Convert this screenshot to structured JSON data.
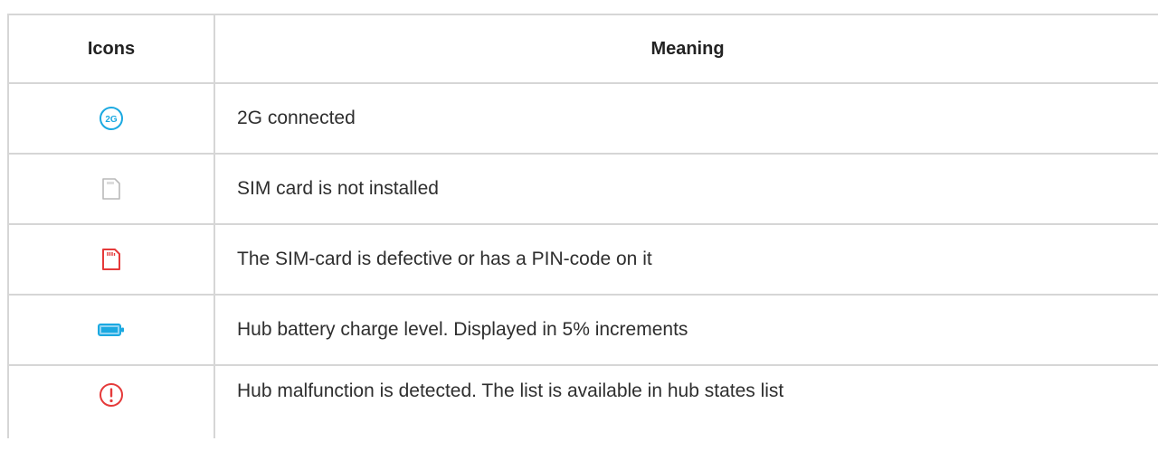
{
  "table": {
    "header": {
      "icons": "Icons",
      "meaning": "Meaning"
    },
    "rows": [
      {
        "icon": "2g-connected-icon",
        "meaning": "2G connected",
        "icon_color": "#1ba9e1"
      },
      {
        "icon": "sim-card-missing-icon",
        "meaning": "SIM card is not installed",
        "icon_color": "#b9b9b9"
      },
      {
        "icon": "sim-card-error-icon",
        "meaning": "The SIM-card is defective or has a PIN-code on it",
        "icon_color": "#e53a3a"
      },
      {
        "icon": "battery-icon",
        "meaning": "Hub battery charge level. Displayed in 5% increments",
        "icon_color": "#1ba9e1"
      },
      {
        "icon": "malfunction-alert-icon",
        "meaning": "Hub malfunction is detected. The list is available in hub states list",
        "icon_color": "#e53a3a"
      }
    ]
  }
}
